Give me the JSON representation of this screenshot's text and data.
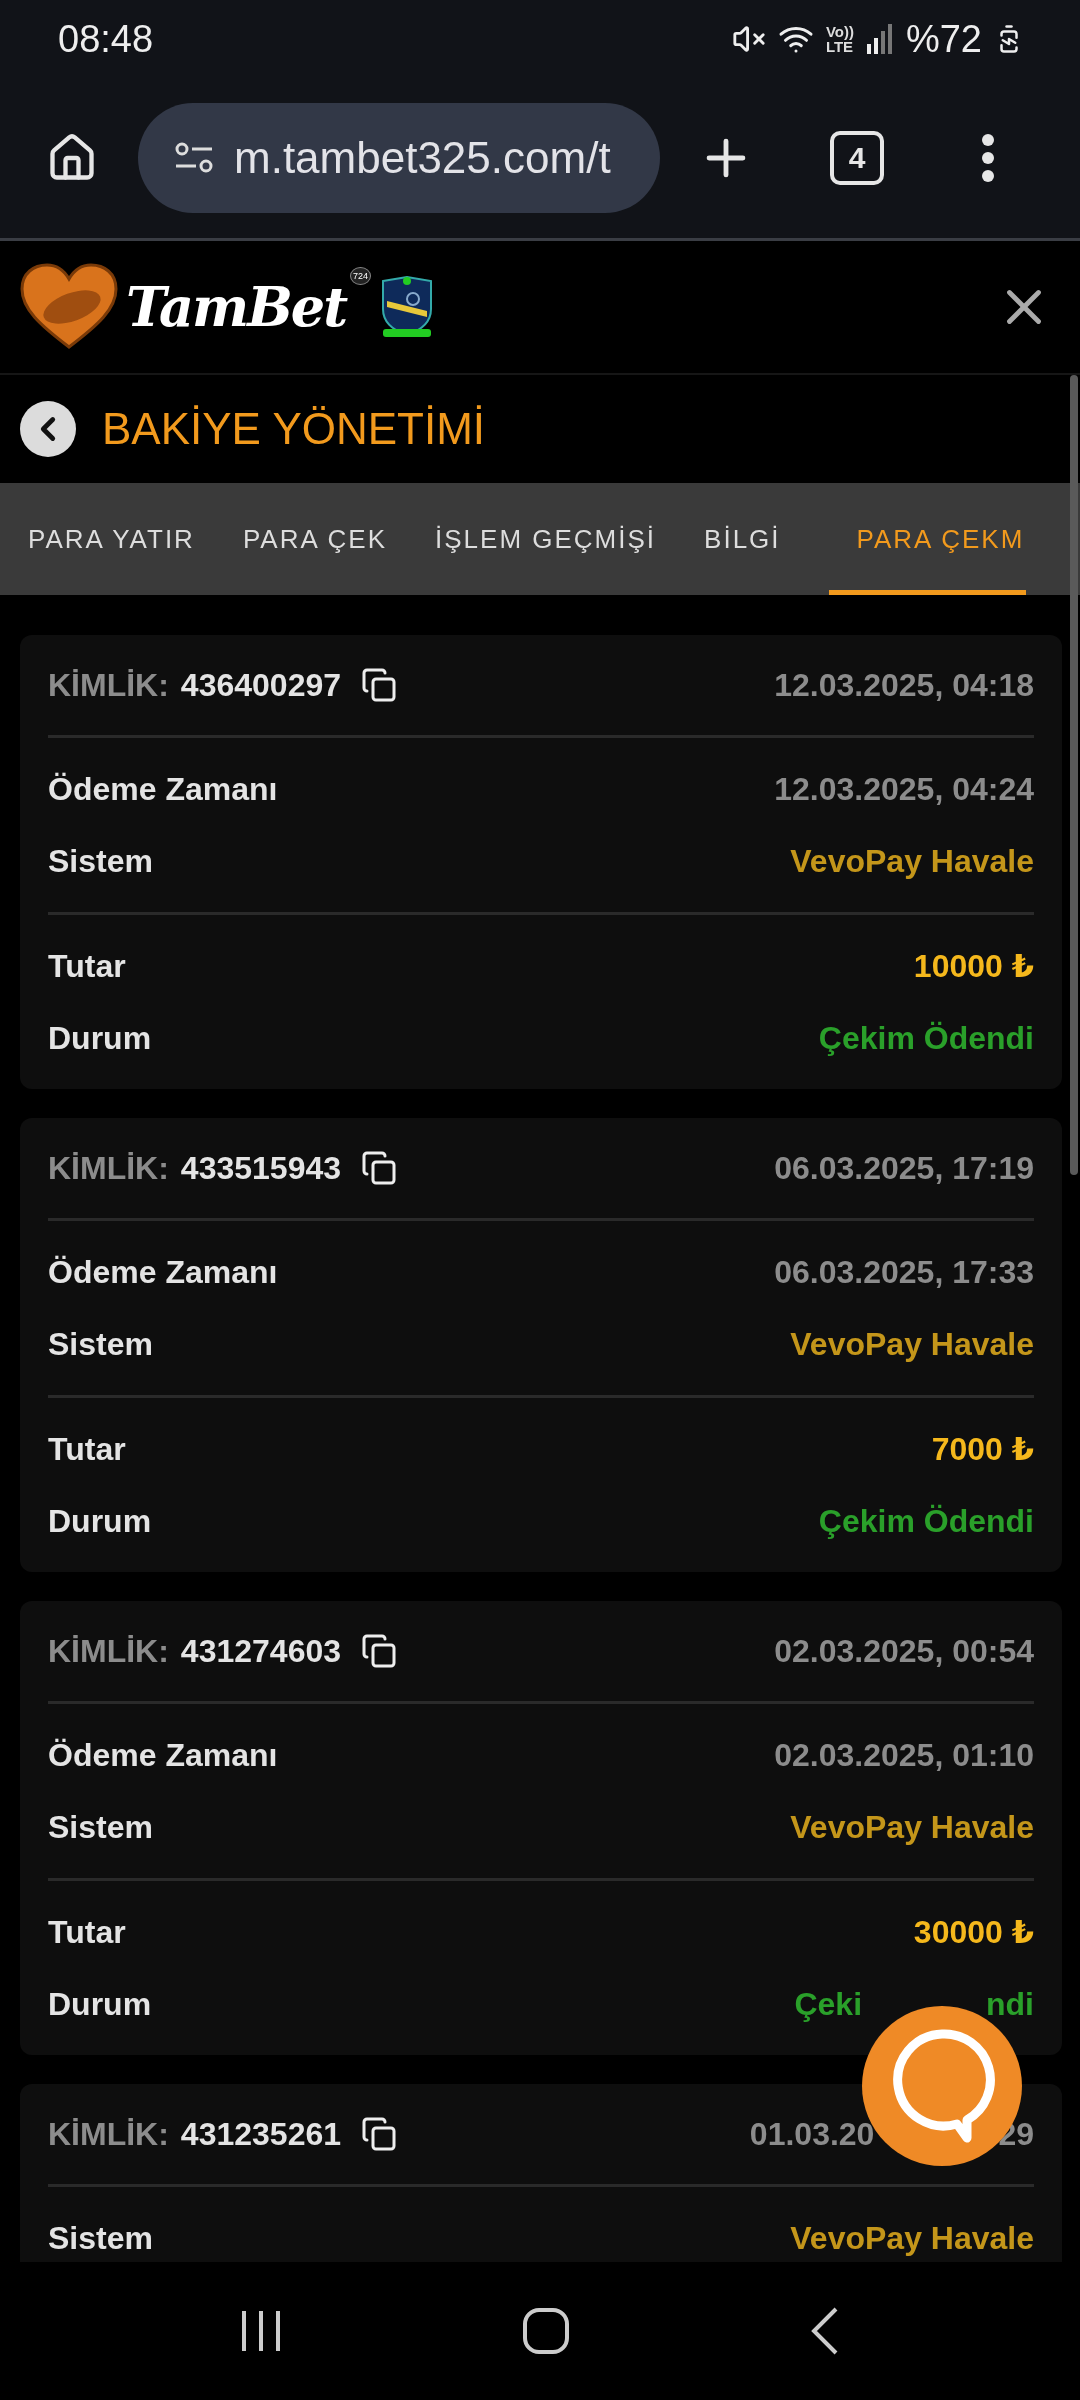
{
  "status_bar": {
    "time": "08:48",
    "network": "Vo))\nLTE",
    "battery": "%72"
  },
  "browser": {
    "url": "m.tambet325.com/t",
    "tab_count": "4"
  },
  "site_header": {
    "logo_text": "TamBet",
    "logo_badge": "724"
  },
  "page_title": "BAKİYE YÖNETİMİ",
  "tabs": [
    {
      "label": "PARA YATIR",
      "selected": false
    },
    {
      "label": "PARA ÇEK",
      "selected": false
    },
    {
      "label": "İŞLEM GEÇMİŞİ",
      "selected": false
    },
    {
      "label": "BİLGİ",
      "selected": false
    },
    {
      "label": "PARA ÇEKM",
      "selected": true
    }
  ],
  "records": [
    {
      "id_label": "KİMLİK:",
      "id": "436400297",
      "created": "12.03.2025, 04:18",
      "groups": [
        [
          {
            "kind": "time",
            "label": "Ödeme Zamanı",
            "value": "12.03.2025, 04:24"
          },
          {
            "kind": "system",
            "label": "Sistem",
            "value": "VevoPay Havale"
          }
        ],
        [
          {
            "kind": "amount",
            "label": "Tutar",
            "value": "10000 ₺"
          },
          {
            "kind": "status",
            "label": "Durum",
            "value": "Çekim Ödendi"
          }
        ]
      ]
    },
    {
      "id_label": "KİMLİK:",
      "id": "433515943",
      "created": "06.03.2025, 17:19",
      "groups": [
        [
          {
            "kind": "time",
            "label": "Ödeme Zamanı",
            "value": "06.03.2025, 17:33"
          },
          {
            "kind": "system",
            "label": "Sistem",
            "value": "VevoPay Havale"
          }
        ],
        [
          {
            "kind": "amount",
            "label": "Tutar",
            "value": "7000 ₺"
          },
          {
            "kind": "status",
            "label": "Durum",
            "value": "Çekim Ödendi"
          }
        ]
      ]
    },
    {
      "id_label": "KİMLİK:",
      "id": "431274603",
      "created": "02.03.2025, 00:54",
      "groups": [
        [
          {
            "kind": "time",
            "label": "Ödeme Zamanı",
            "value": "02.03.2025, 01:10"
          },
          {
            "kind": "system",
            "label": "Sistem",
            "value": "VevoPay Havale"
          }
        ],
        [
          {
            "kind": "amount",
            "label": "Tutar",
            "value": "30000 ₺"
          },
          {
            "kind": "status",
            "label": "Durum",
            "parts": [
              "Çeki",
              "ndi"
            ]
          }
        ]
      ]
    },
    {
      "id_label": "KİMLİK:",
      "id": "431235261",
      "created_parts": [
        "01.03.20",
        "29"
      ],
      "groups": [
        [
          {
            "kind": "system",
            "label": "Sistem",
            "value": "VevoPay Havale"
          }
        ]
      ]
    }
  ]
}
